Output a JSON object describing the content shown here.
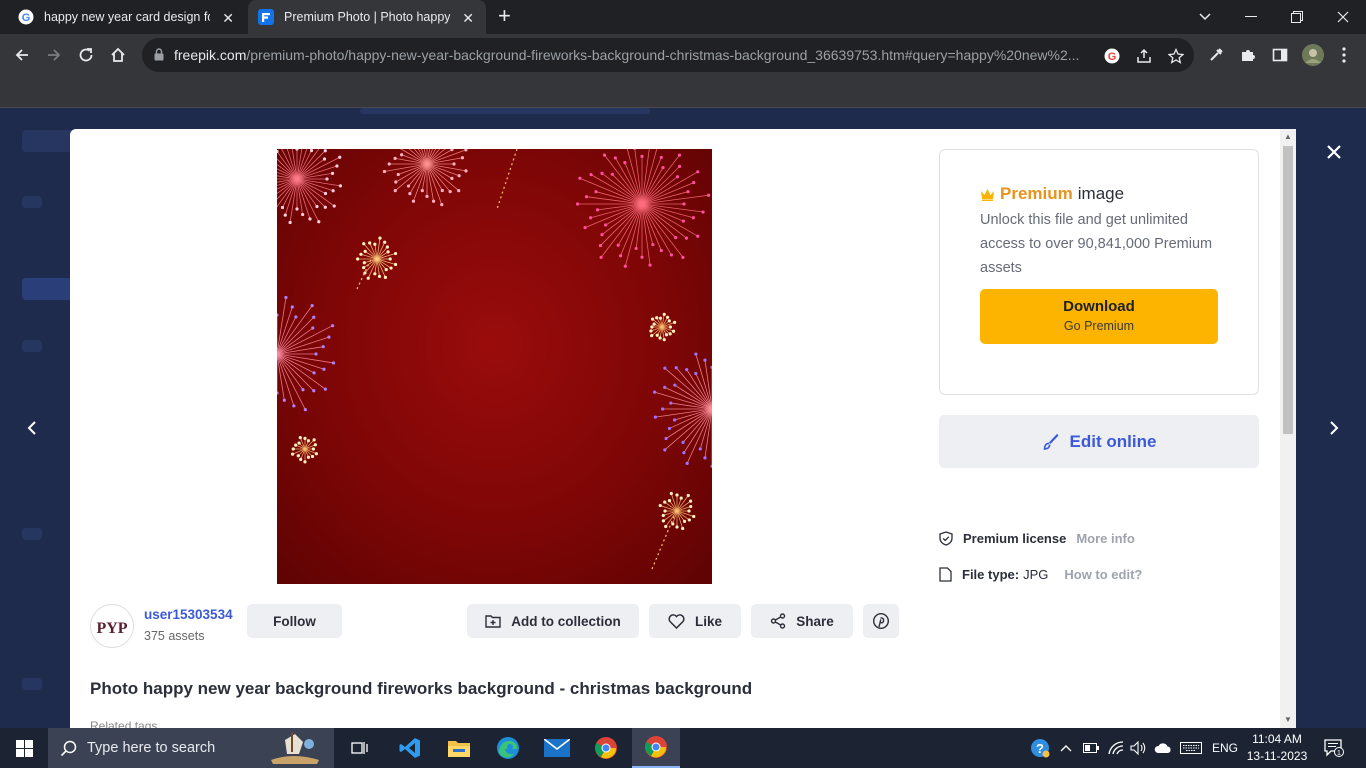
{
  "browser": {
    "tabs": [
      {
        "title": "happy new year card design for t",
        "active": false
      },
      {
        "title": "Premium Photo | Photo happy ne",
        "active": true
      }
    ],
    "url_host": "freepik.com",
    "url_path": "/premium-photo/happy-new-year-background-fireworks-background-christmas-background_36639753.htm#query=happy%20new%2..."
  },
  "modal": {
    "author": {
      "name": "user15303534",
      "assets": "375 assets",
      "avatar_text": "PYP"
    },
    "buttons": {
      "follow": "Follow",
      "add_to_collection": "Add to collection",
      "like": "Like",
      "share": "Share"
    },
    "title": "Photo happy new year background fireworks background - christmas background",
    "related_tags": "Related tags",
    "premium": {
      "highlight": "Premium",
      "suffix": "image",
      "description": "Unlock this file and get unlimited access to over 90,841,000 Premium assets",
      "download_label": "Download",
      "download_sub": "Go Premium"
    },
    "edit_online": "Edit online",
    "license": {
      "label": "Premium license",
      "link": "More info"
    },
    "file_type": {
      "label": "File type:",
      "value": "JPG",
      "link": "How to edit?"
    }
  },
  "taskbar": {
    "search_placeholder": "Type here to search",
    "language": "ENG",
    "time": "11:04 AM",
    "date": "13-11-2023",
    "notifications": "1"
  },
  "colors": {
    "accent_blue": "#3a5ad9",
    "premium_orange": "#e8931b",
    "download_yellow": "#fcb400"
  }
}
